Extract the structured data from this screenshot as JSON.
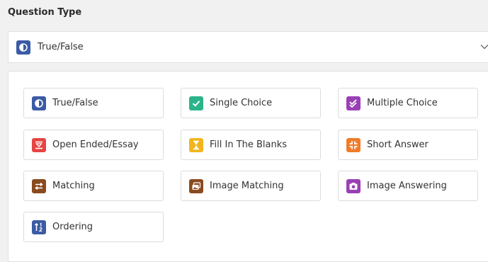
{
  "question_type": {
    "label": "Question Type",
    "selected": {
      "label": "True/False",
      "icon": "true-false-icon",
      "color": "#3b5ba5"
    }
  },
  "options": [
    {
      "label": "True/False",
      "icon": "true-false-icon",
      "color": "#3b5ba5"
    },
    {
      "label": "Single Choice",
      "icon": "checkmark-icon",
      "color": "#2bb38a"
    },
    {
      "label": "Multiple Choice",
      "icon": "double-check-icon",
      "color": "#9b3fb5"
    },
    {
      "label": "Open Ended/Essay",
      "icon": "essay-icon",
      "color": "#e64545"
    },
    {
      "label": "Fill In The Blanks",
      "icon": "hourglass-icon",
      "color": "#f2b51d"
    },
    {
      "label": "Short Answer",
      "icon": "compress-icon",
      "color": "#f07c2a"
    },
    {
      "label": "Matching",
      "icon": "arrows-exchange-icon",
      "color": "#8a4a1f"
    },
    {
      "label": "Image Matching",
      "icon": "image-stack-icon",
      "color": "#8a4a1f"
    },
    {
      "label": "Image Answering",
      "icon": "camera-icon",
      "color": "#9b3fb5"
    },
    {
      "label": "Ordering",
      "icon": "sort-numeric-icon",
      "color": "#3b5ba5"
    }
  ]
}
